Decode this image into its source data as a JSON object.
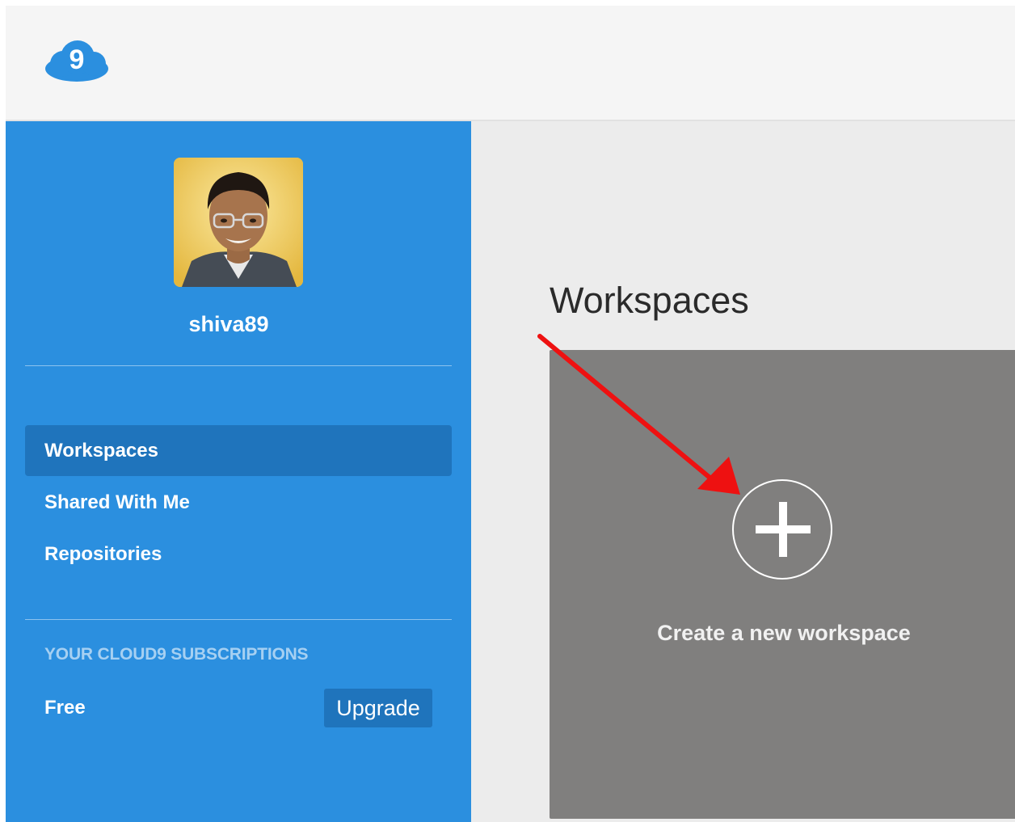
{
  "topbar": {
    "logo_icon": "cloud9-logo-icon",
    "logo_text": "9",
    "brand_color": "#2b8fdf"
  },
  "sidebar": {
    "username": "shiva89",
    "avatar_icon": "user-avatar",
    "nav": [
      {
        "label": "Workspaces",
        "active": true
      },
      {
        "label": "Shared With Me",
        "active": false
      },
      {
        "label": "Repositories",
        "active": false
      }
    ],
    "subscriptions_heading": "YOUR CLOUD9 SUBSCRIPTIONS",
    "plan": "Free",
    "upgrade_label": "Upgrade",
    "colors": {
      "background": "#2b8fdf",
      "active_item": "#1f74bc"
    }
  },
  "main": {
    "title": "Workspaces",
    "create_card": {
      "icon": "plus-circle-icon",
      "label": "Create a new workspace",
      "background": "#807f7e"
    },
    "annotation": {
      "icon": "red-arrow-icon",
      "color": "#ee1111"
    }
  }
}
